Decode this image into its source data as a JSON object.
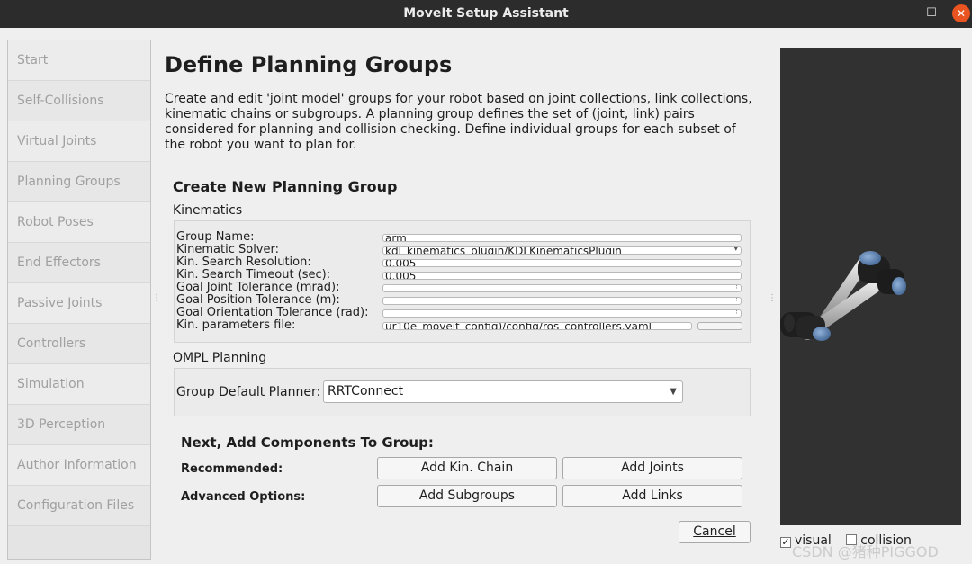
{
  "window": {
    "title": "MoveIt Setup Assistant"
  },
  "sidebar": {
    "items": [
      {
        "label": "Start"
      },
      {
        "label": "Self-Collisions"
      },
      {
        "label": "Virtual Joints"
      },
      {
        "label": "Planning Groups"
      },
      {
        "label": "Robot Poses"
      },
      {
        "label": "End Effectors"
      },
      {
        "label": "Passive Joints"
      },
      {
        "label": "Controllers"
      },
      {
        "label": "Simulation"
      },
      {
        "label": "3D Perception"
      },
      {
        "label": "Author Information"
      },
      {
        "label": "Configuration Files"
      }
    ]
  },
  "main": {
    "title": "Define Planning Groups",
    "description": "Create and edit 'joint model' groups for your robot based on joint collections, link collections, kinematic chains or subgroups. A planning group defines the set of (joint, link) pairs considered for planning and collision checking. Define individual groups for each subset of the robot you want to plan for.",
    "create_heading": "Create New Planning Group",
    "kinematics": {
      "heading": "Kinematics",
      "group_name_label": "Group Name:",
      "group_name_value": "arm",
      "solver_label": "Kinematic Solver:",
      "solver_value": "kdl_kinematics_plugin/KDLKinematicsPlugin",
      "search_res_label": "Kin. Search Resolution:",
      "search_res_value": "0.005",
      "search_timeout_label": "Kin. Search Timeout (sec):",
      "search_timeout_value": "0.005",
      "joint_tol_label": "Goal Joint Tolerance (mrad):",
      "position_tol_label": "Goal Position Tolerance (m):",
      "orientation_tol_label": "Goal Orientation Tolerance (rad):",
      "params_file_label": "Kin. parameters file:",
      "params_file_value": "ur10e_moveit_config)/config/ros_controllers.yaml"
    },
    "ompl": {
      "heading": "OMPL Planning",
      "planner_label": "Group Default Planner:",
      "planner_value": "RRTConnect"
    },
    "next": {
      "heading": "Next, Add Components To Group:",
      "recommended_label": "Recommended:",
      "advanced_label": "Advanced Options:",
      "add_kin_chain": "Add Kin. Chain",
      "add_joints": "Add Joints",
      "add_subgroups": "Add Subgroups",
      "add_links": "Add Links"
    },
    "cancel_label": "Cancel"
  },
  "view": {
    "visual_label": "visual",
    "visual_checked": true,
    "collision_label": "collision",
    "collision_checked": false
  },
  "watermark": "CSDN @猪种PIGGOD",
  "colors": {
    "titlebar": "#2c2c2c",
    "close_button": "#e95420",
    "viewport_bg": "#313131"
  }
}
